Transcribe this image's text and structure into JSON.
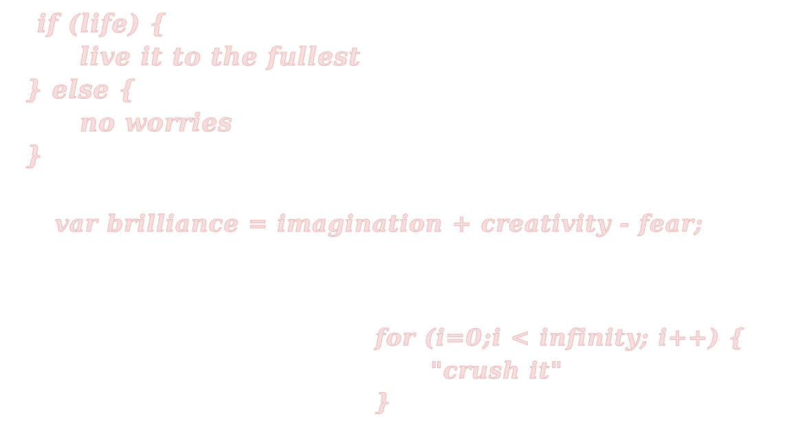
{
  "block_if_else": {
    "line1": "if (life) {",
    "line2": "live it to the fullest",
    "line3": "} else {",
    "line4": "no worries",
    "line5": "}"
  },
  "block_var": {
    "line1": "var brilliance = imagination + creativity - fear;"
  },
  "block_for": {
    "line1": "for (i=0;i < infinity; i++) {",
    "line2": "\"crush it\"",
    "line3": "}"
  },
  "colors": {
    "text_fill": "#f7dede",
    "text_outline": "#e9b7b7",
    "background": "#ffffff"
  }
}
